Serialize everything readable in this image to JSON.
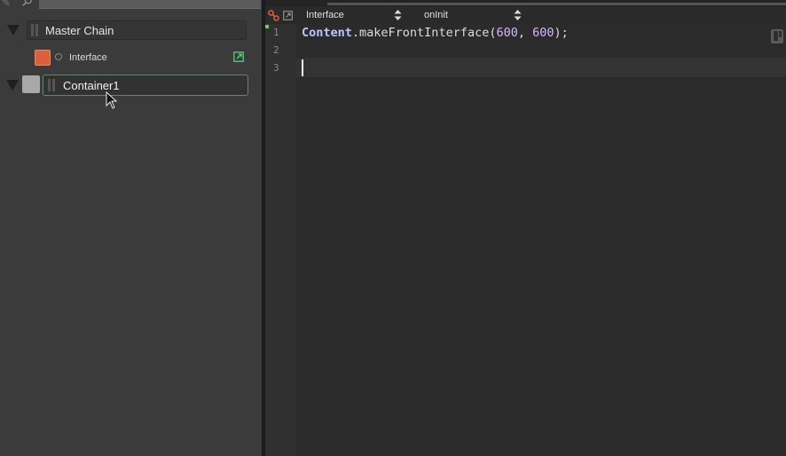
{
  "left_panel": {
    "modules": [
      {
        "name": "Master Chain"
      },
      {
        "name": "Interface"
      },
      {
        "name": "Container1"
      }
    ],
    "colors": {
      "interface": "#dc5f3c",
      "container": "#a8a8a8",
      "selected_border": "#5f8a66"
    }
  },
  "editor": {
    "processor": "Interface",
    "callback": "onInit",
    "line_numbers": [
      "1",
      "2",
      "3"
    ],
    "code": {
      "object": "Content",
      "method": ".makeFrontInterface(",
      "arg1": "600",
      "sep": ", ",
      "arg2": "600",
      "close": ");"
    }
  }
}
